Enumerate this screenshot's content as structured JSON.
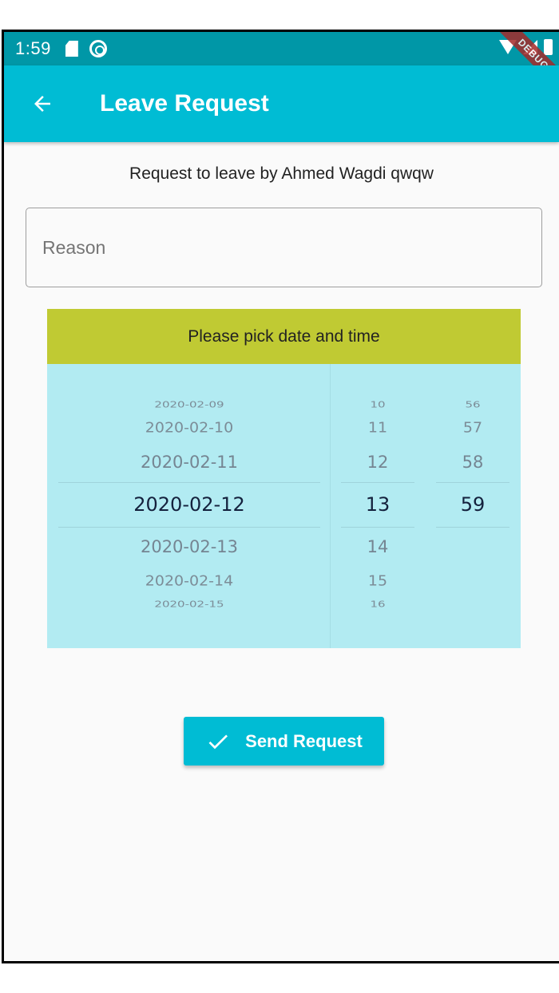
{
  "status_bar": {
    "time": "1:59",
    "icons": [
      "sd-card-icon",
      "sync-icon",
      "wifi-icon",
      "signal-icon",
      "battery-icon"
    ],
    "debug_banner": "DEBUG"
  },
  "app_bar": {
    "title": "Leave Request",
    "back_icon": "arrow-back-icon",
    "color": "#00bcd4"
  },
  "subtitle": "Request to leave by Ahmed Wagdi qwqw",
  "reason_field": {
    "placeholder": "Reason",
    "value": ""
  },
  "picker": {
    "header": "Please pick date and time",
    "header_color": "#c0ca33",
    "background_color": "#b2ebf2",
    "dates": [
      "2020-02-09",
      "2020-02-10",
      "2020-02-11",
      "2020-02-12",
      "2020-02-13",
      "2020-02-14",
      "2020-02-15"
    ],
    "hours": [
      "10",
      "11",
      "12",
      "13",
      "14",
      "15",
      "16"
    ],
    "minutes": [
      "56",
      "57",
      "58",
      "59"
    ],
    "selected": {
      "date": "2020-02-12",
      "hour": "13",
      "minute": "59"
    }
  },
  "send_button": {
    "label": "Send Request",
    "icon": "check-icon",
    "color": "#00bcd4"
  }
}
